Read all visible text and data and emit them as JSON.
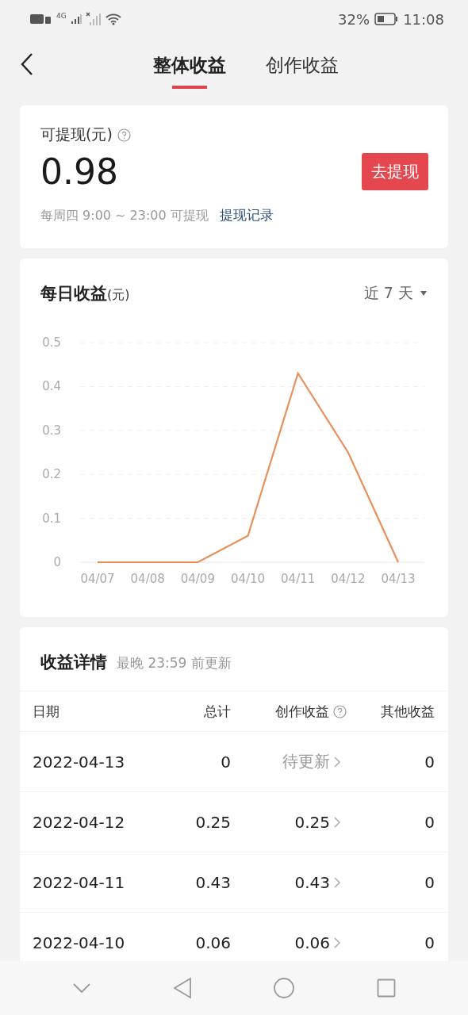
{
  "status_bar": {
    "network": "4G",
    "battery": "32%",
    "time": "11:08"
  },
  "tabs": [
    {
      "label": "整体收益",
      "selected": true
    },
    {
      "label": "创作收益",
      "selected": false
    }
  ],
  "withdraw": {
    "label": "可提现(元)",
    "amount": "0.98",
    "button": "去提现",
    "note": "每周四 9:00 ~ 23:00 可提现",
    "link": "提现记录"
  },
  "daily": {
    "title": "每日收益",
    "unit": "(元)",
    "range": "近 7 天",
    "chart_data": {
      "type": "line",
      "categories": [
        "04/07",
        "04/08",
        "04/09",
        "04/10",
        "04/11",
        "04/12",
        "04/13"
      ],
      "series": [
        {
          "color": "#e8905a",
          "values": [
            0,
            0,
            0,
            0.06,
            0.43,
            0.25,
            0
          ]
        }
      ],
      "grid": true,
      "ylim": [
        0,
        0.5
      ],
      "yticks": [
        {
          "value": 0,
          "label": "0"
        },
        {
          "value": 0.1,
          "label": "0.1"
        },
        {
          "value": 0.2,
          "label": "0.2"
        },
        {
          "value": 0.3,
          "label": "0.3"
        },
        {
          "value": 0.4,
          "label": "0.4"
        },
        {
          "value": 0.5,
          "label": "0.5"
        }
      ]
    }
  },
  "details": {
    "title": "收益详情",
    "subtitle": "最晚 23:59 前更新",
    "columns": [
      "日期",
      "总计",
      "创作收益",
      "其他收益"
    ],
    "rows": [
      {
        "date": "2022-04-13",
        "total": "0",
        "creative": "待更新",
        "pending": true,
        "other": "0"
      },
      {
        "date": "2022-04-12",
        "total": "0.25",
        "creative": "0.25",
        "pending": false,
        "other": "0"
      },
      {
        "date": "2022-04-11",
        "total": "0.43",
        "creative": "0.43",
        "pending": false,
        "other": "0"
      },
      {
        "date": "2022-04-10",
        "total": "0.06",
        "creative": "0.06",
        "pending": false,
        "other": "0"
      }
    ]
  }
}
